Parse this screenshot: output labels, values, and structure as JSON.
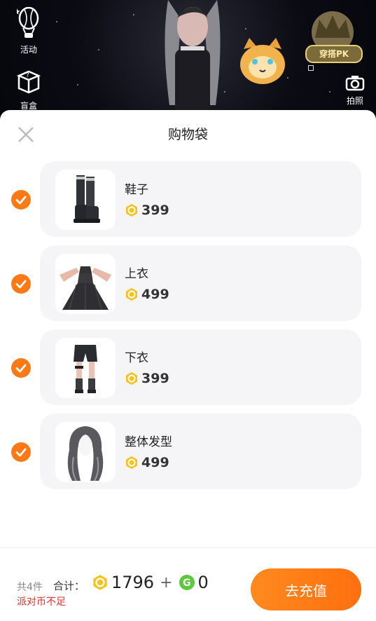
{
  "top_bar": {
    "activity_label": "活动",
    "blindbox_label": "盲盒",
    "photo_label": "拍照",
    "pk_label": "穿搭PK"
  },
  "sheet": {
    "title": "购物袋",
    "items": [
      {
        "name": "鞋子",
        "price": "399",
        "checked": true,
        "thumb_icon": "boots-icon"
      },
      {
        "name": "上衣",
        "price": "499",
        "checked": true,
        "thumb_icon": "dress-icon"
      },
      {
        "name": "下衣",
        "price": "399",
        "checked": true,
        "thumb_icon": "shorts-icon"
      },
      {
        "name": "整体发型",
        "price": "499",
        "checked": true,
        "thumb_icon": "hairstyle-icon"
      }
    ]
  },
  "footer": {
    "count_text": "共4件",
    "total_label": "合计：",
    "total_coins": "1796",
    "plus": "+",
    "g_coins": "0",
    "warning": "派对币不足",
    "recharge_label": "去充值"
  },
  "colors": {
    "accent": "#ff7a17",
    "warning": "#e5302f",
    "coin": "#f4c21c",
    "g_coin": "#5cc83a"
  }
}
